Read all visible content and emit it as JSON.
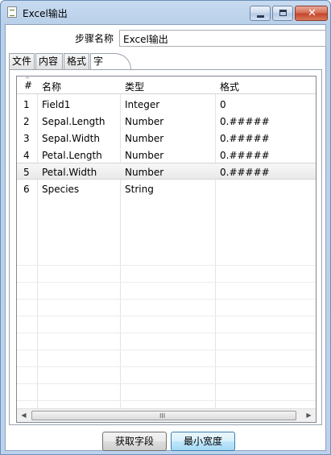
{
  "window": {
    "title": "Excel输出",
    "close_glyph": "✕"
  },
  "step": {
    "label": "步骤名称",
    "value": "Excel输出"
  },
  "tabs": [
    {
      "label": "文件"
    },
    {
      "label": "内容"
    },
    {
      "label": "格式"
    },
    {
      "label": "字段"
    }
  ],
  "active_tab": "字段",
  "table": {
    "columns": [
      "#",
      "名称",
      "类型",
      "格式"
    ],
    "rows": [
      {
        "num": "1",
        "name": "Field1",
        "type": "Integer",
        "format": "0"
      },
      {
        "num": "2",
        "name": "Sepal.Length",
        "type": "Number",
        "format": "0.#####"
      },
      {
        "num": "3",
        "name": "Sepal.Width",
        "type": "Number",
        "format": "0.#####"
      },
      {
        "num": "4",
        "name": "Petal.Length",
        "type": "Number",
        "format": "0.#####"
      },
      {
        "num": "5",
        "name": "Petal.Width",
        "type": "Number",
        "format": "0.#####"
      },
      {
        "num": "6",
        "name": "Species",
        "type": "String",
        "format": ""
      }
    ],
    "selected_row": "5"
  },
  "scrollbar": {
    "left_arrow": "◀",
    "right_arrow": "▶",
    "grip": "III"
  },
  "buttons": {
    "get_fields": "获取字段",
    "min_width": "最小宽度"
  }
}
